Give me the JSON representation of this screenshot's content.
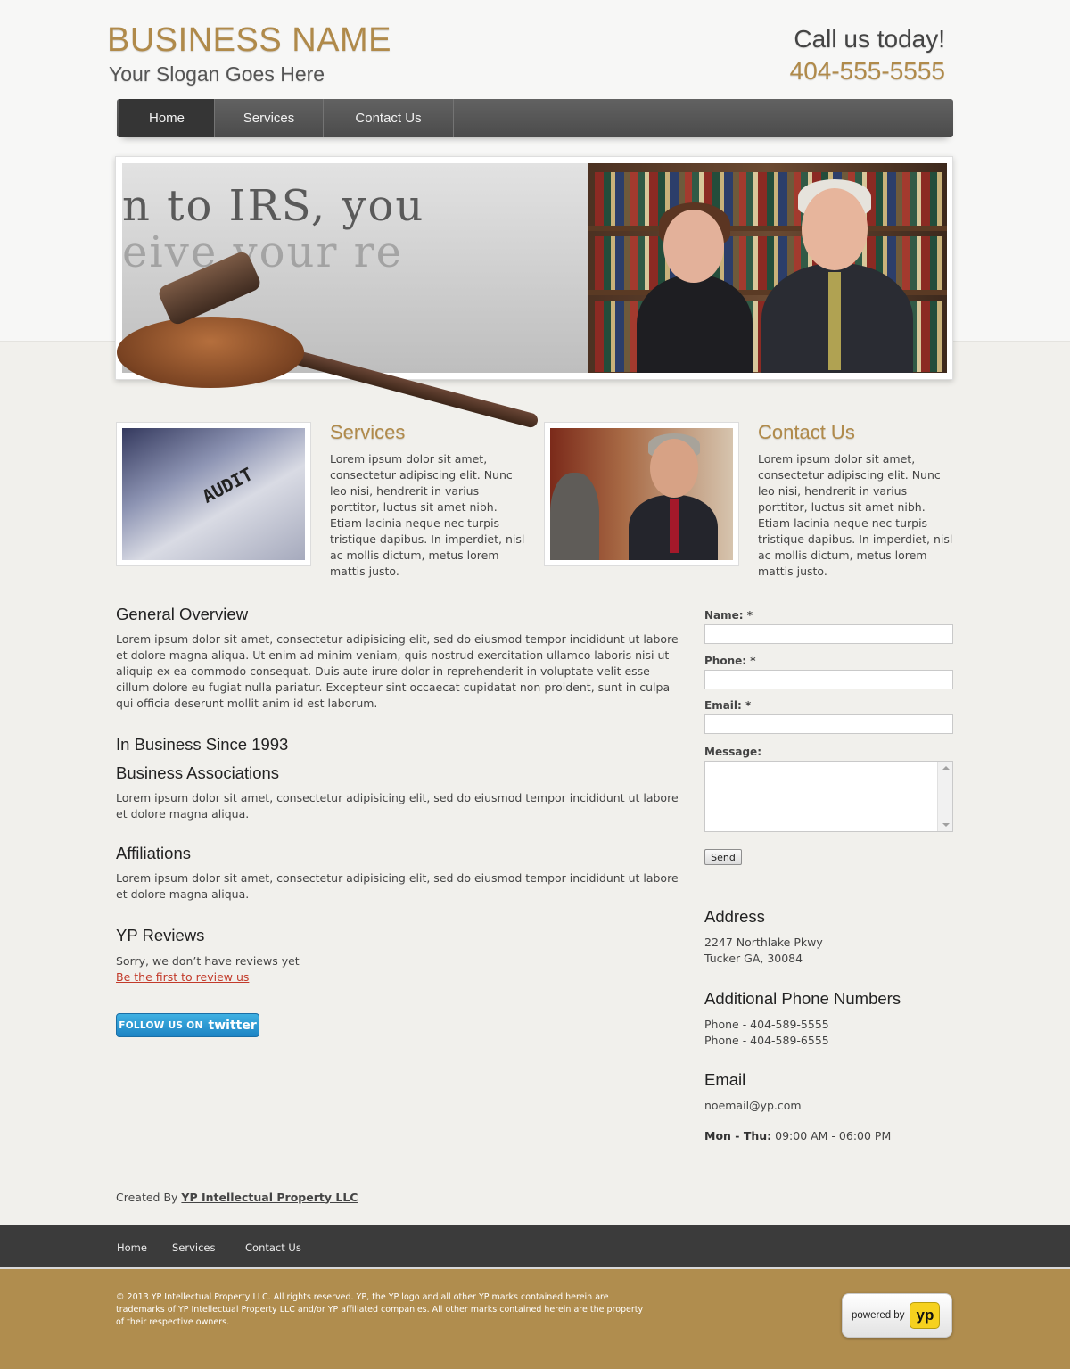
{
  "header": {
    "business_name": "BUSINESS NAME",
    "slogan": "Your Slogan Goes Here",
    "call_text": "Call us today!",
    "phone": "404-555-5555"
  },
  "nav": {
    "items": [
      {
        "label": "Home",
        "active": true
      },
      {
        "label": "Services",
        "active": false
      },
      {
        "label": "Contact Us",
        "active": false
      }
    ]
  },
  "banner": {
    "doc_text": "n to IRS, you",
    "doc_text_2": "eive your re"
  },
  "features": [
    {
      "title": "Services",
      "image": "audit-document-image",
      "image_word": "AUDIT",
      "text": "Lorem ipsum dolor sit amet, consectetur adipiscing elit. Nunc leo nisi, hendrerit in varius porttitor, luctus sit amet nibh. Etiam lacinia neque nec turpis tristique dapibus. In imperdiet, nisl ac mollis dictum, metus lorem mattis justo."
    },
    {
      "title": "Contact Us",
      "image": "lawyer-with-client-image",
      "text": "Lorem ipsum dolor sit amet, consectetur adipiscing elit. Nunc leo nisi, hendrerit in varius porttitor, luctus sit amet nibh. Etiam lacinia neque nec turpis tristique dapibus. In imperdiet, nisl ac mollis dictum, metus lorem mattis justo."
    }
  ],
  "main": {
    "overview_title": "General Overview",
    "overview_text": "Lorem ipsum dolor sit amet, consectetur adipisicing elit, sed do eiusmod tempor incididunt ut labore et dolore magna aliqua. Ut enim ad minim veniam, quis nostrud exercitation ullamco laboris nisi ut aliquip ex ea commodo consequat. Duis aute irure dolor in reprehenderit in voluptate velit esse cillum dolore eu fugiat nulla pariatur. Excepteur sint occaecat cupidatat non proident, sunt in culpa qui officia deserunt mollit anim id est laborum.",
    "since_title": "In Business Since 1993",
    "associations_title": "Business Associations",
    "associations_text": "Lorem ipsum dolor sit amet, consectetur adipisicing elit, sed do eiusmod tempor incididunt ut labore et dolore magna aliqua.",
    "affiliations_title": "Affiliations",
    "affiliations_text": "Lorem ipsum dolor sit amet, consectetur adipisicing elit, sed do eiusmod tempor incididunt ut labore et dolore magna aliqua.",
    "reviews_title": "YP Reviews",
    "reviews_text": "Sorry, we don’t have reviews yet",
    "review_link": "Be the first to review us",
    "twitter_prefix": "FOLLOW US ON",
    "twitter_brand": "twitter"
  },
  "form": {
    "name_label": "Name: *",
    "phone_label": "Phone: *",
    "email_label": "Email: *",
    "message_label": "Message:",
    "name_value": "",
    "phone_value": "",
    "email_value": "",
    "message_value": "",
    "send_label": "Send"
  },
  "sidebar": {
    "address_title": "Address",
    "address_line1": "2247 Northlake Pkwy",
    "address_line2": "Tucker GA, 30084",
    "phones_title": "Additional Phone Numbers",
    "phone1": "Phone - 404-589-5555",
    "phone2": "Phone - 404-589-6555",
    "email_title": "Email",
    "email": "noemail@yp.com",
    "hours_days": "Mon - Thu:",
    "hours_time": "09:00 AM - 06:00 PM"
  },
  "credits": {
    "created_by": "Created By",
    "company": "YP Intellectual Property LLC"
  },
  "footer": {
    "nav": [
      "Home",
      "Services",
      "Contact Us"
    ],
    "copyright": "© 2013  YP Intellectual Property LLC. All rights reserved. YP, the YP logo and all other YP marks contained herein are trademarks of YP Intellectual Property LLC and/or YP affiliated companies. All other marks contained herein are the property of their respective owners.",
    "powered_by": "powered by",
    "yp_logo": "yp"
  },
  "colors": {
    "brand_gold": "#b08a4a",
    "nav_dark": "#4b4b4b",
    "footer_gold": "#b08d4e",
    "link_red": "#c23a2a",
    "twitter_blue": "#1e84c4"
  }
}
